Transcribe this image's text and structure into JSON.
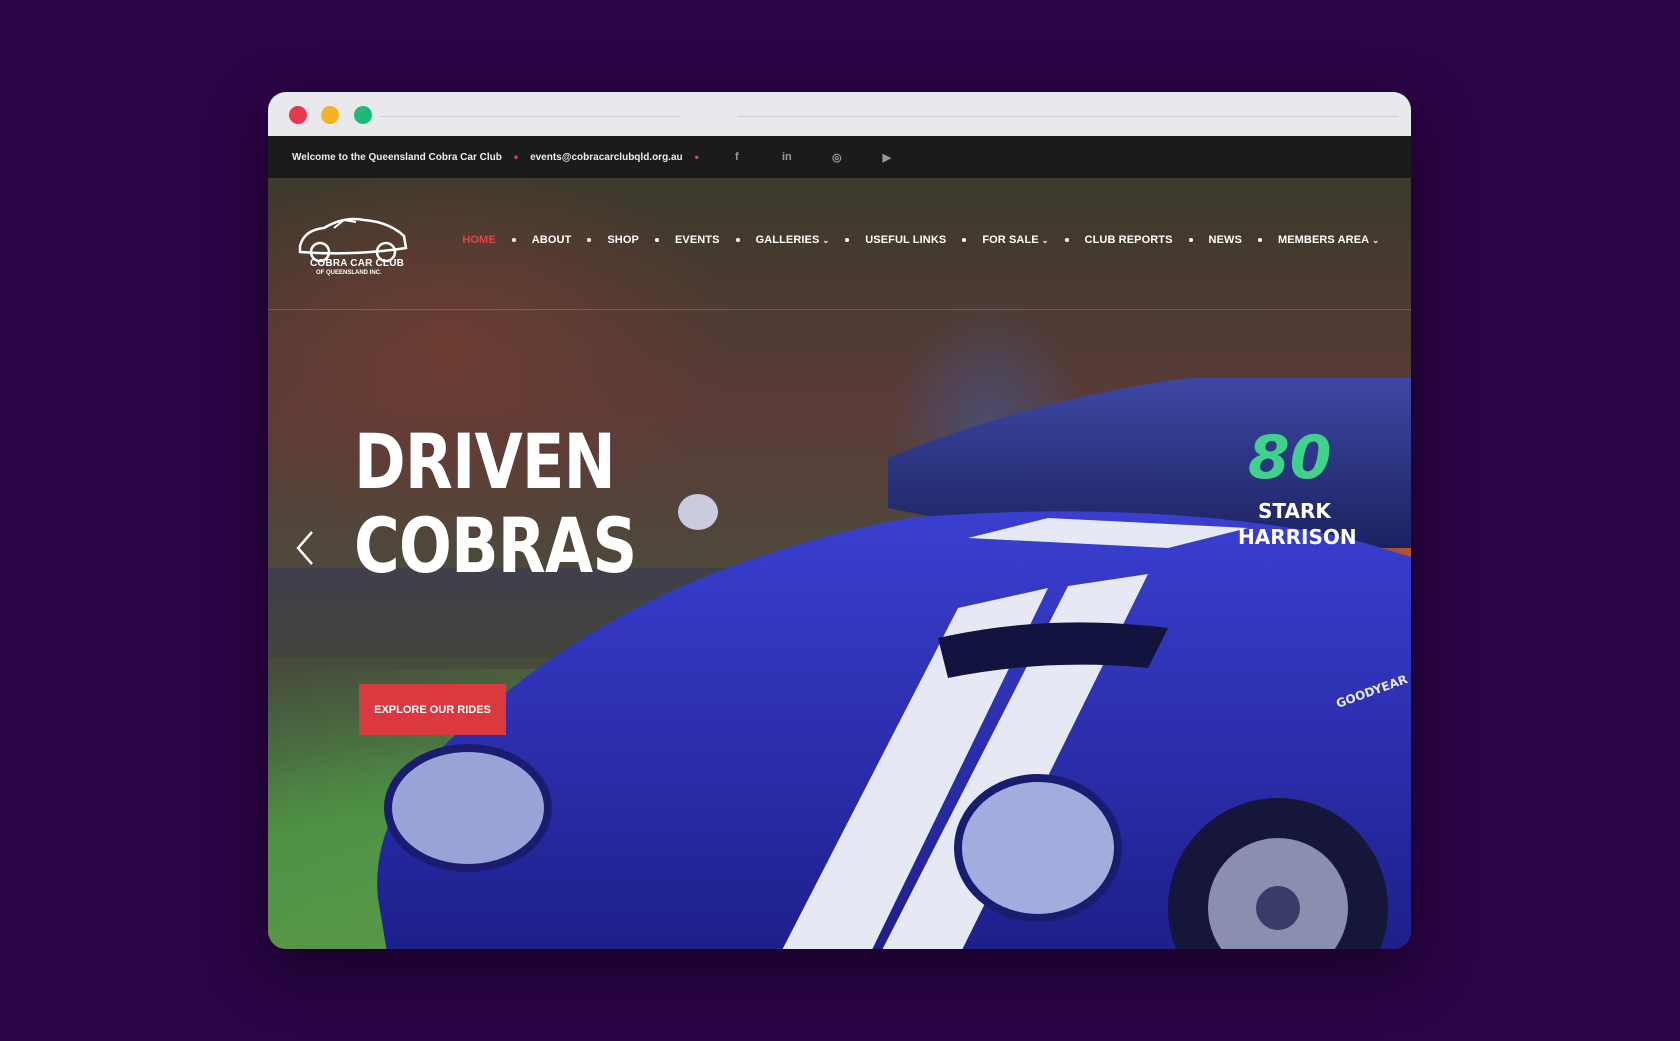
{
  "topbar": {
    "welcome": "Welcome to the Queensland Cobra Car Club",
    "email": "events@cobracarclubqld.org.au",
    "social_icons": [
      "facebook-icon",
      "linkedin-icon",
      "instagram-icon",
      "youtube-icon"
    ],
    "social_glyphs": [
      "f",
      "in",
      "◎",
      "▶"
    ]
  },
  "logo": {
    "line1": "COBRA CAR CLUB",
    "line2": "OF QUEENSLAND INC."
  },
  "nav": {
    "home": "HOME",
    "about": "ABOUT",
    "shop": "SHOP",
    "events": "EVENTS",
    "galleries": "GALLERIES",
    "useful_links": "USEFUL LINKS",
    "for_sale": "FOR SALE",
    "club_reports": "CLUB REPORTS",
    "news": "NEWS",
    "members_area": "MEMBERS AREA"
  },
  "hero": {
    "headline_line1": "DRIVEN",
    "headline_line2": "COBRAS",
    "cta_label": "EXPLORE OUR RIDES",
    "car_number": "80",
    "car_name1": "STARK",
    "car_name2": "HARRISON",
    "sponsor": "GOODYEAR"
  },
  "colors": {
    "page_background": "#2a0445",
    "accent": "#d9393f",
    "active_nav": "#e2434c",
    "car_blue": "#2c2fb0",
    "number_green": "#3fd28a"
  }
}
